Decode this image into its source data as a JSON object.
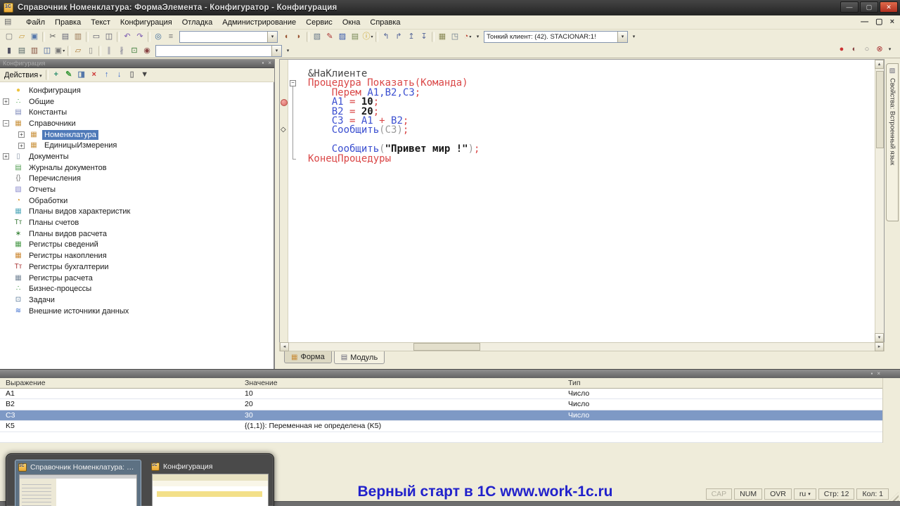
{
  "window": {
    "title": "Справочник Номенклатура: ФормаЭлемента - Конфигуратор - Конфигурация"
  },
  "menu": {
    "items": [
      {
        "n": "file",
        "label": "Файл"
      },
      {
        "n": "edit",
        "label": "Правка"
      },
      {
        "n": "text",
        "label": "Текст"
      },
      {
        "n": "configuration",
        "label": "Конфигурация"
      },
      {
        "n": "debug",
        "label": "Отладка"
      },
      {
        "n": "administration",
        "label": "Администрирование"
      },
      {
        "n": "service",
        "label": "Сервис"
      },
      {
        "n": "windows",
        "label": "Окна"
      },
      {
        "n": "help",
        "label": "Справка"
      }
    ]
  },
  "toolbar1": {
    "search_value": "",
    "client_combo": "Тонкий клиент: (42). STACIONAR:1!",
    "icons_a": [
      {
        "n": "new",
        "g": "▢",
        "c": "#777777"
      },
      {
        "n": "open",
        "g": "▱",
        "c": "#c89b3c"
      },
      {
        "n": "save",
        "g": "▣",
        "c": "#5577aa"
      },
      {
        "sep": true
      },
      {
        "n": "cut",
        "g": "✂",
        "c": "#555555"
      },
      {
        "n": "copy",
        "g": "▤",
        "c": "#666677"
      },
      {
        "n": "paste",
        "g": "▥",
        "c": "#997755"
      },
      {
        "sep": true
      },
      {
        "n": "print",
        "g": "▭",
        "c": "#555566"
      },
      {
        "n": "print-preview",
        "g": "◫",
        "c": "#555566"
      },
      {
        "sep": true
      },
      {
        "n": "back",
        "g": "↶",
        "c": "#7a5ab0"
      },
      {
        "n": "forward",
        "g": "↷",
        "c": "#7a5ab0"
      },
      {
        "sep": true
      },
      {
        "n": "find",
        "g": "◎",
        "c": "#3a6a9a"
      },
      {
        "n": "find-list",
        "g": "≡",
        "c": "#777777"
      }
    ],
    "icons_b": [
      {
        "n": "find-next",
        "g": "◖",
        "c": "#995533"
      },
      {
        "n": "find-prev",
        "g": "◗",
        "c": "#995533"
      },
      {
        "sep": true
      },
      {
        "n": "open-module",
        "g": "▧",
        "c": "#667788"
      },
      {
        "n": "syntax-check",
        "g": "✎",
        "c": "#aa3333"
      },
      {
        "n": "edit-object",
        "g": "▨",
        "c": "#3355aa"
      },
      {
        "n": "help-contents",
        "g": "▤",
        "c": "#778855"
      },
      {
        "n": "info",
        "g": "ⓘ",
        "c": "#c8a020",
        "arrow": true
      },
      {
        "sep": true
      },
      {
        "n": "proc-prev",
        "g": "↰",
        "c": "#556699"
      },
      {
        "n": "proc-next",
        "g": "↱",
        "c": "#556699"
      },
      {
        "n": "proc-list",
        "g": "↥",
        "c": "#556699"
      },
      {
        "n": "goto-definition",
        "g": "↧",
        "c": "#556699"
      },
      {
        "sep": true
      },
      {
        "n": "template",
        "g": "▦",
        "c": "#888855"
      },
      {
        "n": "show-calls",
        "g": "◳",
        "c": "#667788"
      },
      {
        "n": "performance-measure",
        "g": "◔",
        "c": "#bb4433",
        "arrow": true
      }
    ]
  },
  "toolbar2": {
    "proc_combo": "",
    "icons": [
      {
        "n": "lock",
        "g": "▮",
        "c": "#555566"
      },
      {
        "n": "properties",
        "g": "▤",
        "c": "#556666"
      },
      {
        "n": "output-table",
        "g": "▥",
        "c": "#885544"
      },
      {
        "n": "form-editor",
        "g": "◫",
        "c": "#3a5a9a"
      },
      {
        "n": "add-wizard",
        "g": "▣",
        "c": "#777777",
        "arrow": true
      },
      {
        "sep": true
      },
      {
        "n": "copy-fragment",
        "g": "▱",
        "c": "#aa7733"
      },
      {
        "n": "delete-fragment",
        "g": "▯",
        "c": "#888888"
      },
      {
        "sep": true
      },
      {
        "n": "comment",
        "g": "∥",
        "c": "#888899"
      },
      {
        "n": "uncomment",
        "g": "∦",
        "c": "#888899"
      },
      {
        "n": "syntax-check-module",
        "g": "⊡",
        "c": "#3a7a3a"
      },
      {
        "n": "find-procedure",
        "g": "◉",
        "c": "#884444"
      }
    ],
    "right_icons": [
      {
        "n": "breakpoint",
        "g": "●",
        "c": "#cc3333"
      },
      {
        "n": "breakpoint-temp",
        "g": "◐",
        "c": "#884444"
      },
      {
        "n": "breakpoint-disable",
        "g": "○",
        "c": "#888888"
      },
      {
        "n": "breakpoints-clear",
        "g": "⊗",
        "c": "#aa3333"
      }
    ]
  },
  "left_panel": {
    "caption": "Конфигурация",
    "actions_label": "Действия",
    "action_icons": [
      {
        "n": "add",
        "g": "+",
        "c": "#2f8f6f"
      },
      {
        "n": "edit",
        "g": "✎",
        "c": "#3f9a3f"
      },
      {
        "n": "copy",
        "g": "◨",
        "c": "#5577aa"
      },
      {
        "n": "delete",
        "g": "×",
        "c": "#cc3333"
      },
      {
        "n": "move-up",
        "g": "↑",
        "c": "#3366cc"
      },
      {
        "n": "move-down",
        "g": "↓",
        "c": "#3366cc"
      },
      {
        "n": "properties",
        "g": "▯",
        "c": "#777777"
      },
      {
        "n": "filter",
        "g": "▼",
        "c": "#444444"
      }
    ],
    "tree": [
      {
        "n": "config",
        "label": "Конфигурация",
        "level": 0,
        "exp": "",
        "icon": {
          "g": "●",
          "c": "#eec23c"
        }
      },
      {
        "n": "common",
        "label": "Общие",
        "level": 0,
        "exp": "+",
        "icon": {
          "g": "∴",
          "c": "#3a9a3a"
        }
      },
      {
        "n": "constants",
        "label": "Константы",
        "level": 0,
        "exp": "",
        "icon": {
          "g": "▤",
          "c": "#7a86b8"
        }
      },
      {
        "n": "catalogs",
        "label": "Справочники",
        "level": 0,
        "exp": "−",
        "icon": {
          "g": "▦",
          "c": "#c9923d"
        }
      },
      {
        "n": "nomenclature",
        "label": "Номенклатура",
        "level": 1,
        "exp": "+",
        "icon": {
          "g": "▦",
          "c": "#c9923d"
        },
        "sel": true
      },
      {
        "n": "units",
        "label": "ЕдиницыИзмерения",
        "level": 1,
        "exp": "+",
        "icon": {
          "g": "▦",
          "c": "#c9923d"
        }
      },
      {
        "n": "documents",
        "label": "Документы",
        "level": 0,
        "exp": "+",
        "icon": {
          "g": "▯",
          "c": "#8a97a8"
        }
      },
      {
        "n": "journals",
        "label": "Журналы документов",
        "level": 0,
        "exp": "",
        "icon": {
          "g": "▤",
          "c": "#55a055"
        }
      },
      {
        "n": "enums",
        "label": "Перечисления",
        "level": 0,
        "exp": "",
        "icon": {
          "g": "{}",
          "c": "#777777"
        }
      },
      {
        "n": "reports",
        "label": "Отчеты",
        "level": 0,
        "exp": "",
        "icon": {
          "g": "▧",
          "c": "#8a8acc"
        }
      },
      {
        "n": "processors",
        "label": "Обработки",
        "level": 0,
        "exp": "",
        "icon": {
          "g": "◔",
          "c": "#d89a30"
        }
      },
      {
        "n": "char-types",
        "label": "Планы видов характеристик",
        "level": 0,
        "exp": "",
        "icon": {
          "g": "▦",
          "c": "#55aabb"
        }
      },
      {
        "n": "accounts",
        "label": "Планы счетов",
        "level": 0,
        "exp": "",
        "icon": {
          "g": "Тт",
          "c": "#3a7a3a"
        }
      },
      {
        "n": "calc-types",
        "label": "Планы видов расчета",
        "level": 0,
        "exp": "",
        "icon": {
          "g": "∗",
          "c": "#2a7a2a"
        }
      },
      {
        "n": "info-registers",
        "label": "Регистры сведений",
        "level": 0,
        "exp": "",
        "icon": {
          "g": "▦",
          "c": "#4a9a4a"
        }
      },
      {
        "n": "accum-registers",
        "label": "Регистры накопления",
        "level": 0,
        "exp": "",
        "icon": {
          "g": "▦",
          "c": "#cc8833"
        }
      },
      {
        "n": "acc-registers",
        "label": "Регистры бухгалтерии",
        "level": 0,
        "exp": "",
        "icon": {
          "g": "Тт",
          "c": "#aa3333"
        }
      },
      {
        "n": "calc-registers",
        "label": "Регистры расчета",
        "level": 0,
        "exp": "",
        "icon": {
          "g": "▦",
          "c": "#778899"
        }
      },
      {
        "n": "business-processes",
        "label": "Бизнес-процессы",
        "level": 0,
        "exp": "",
        "icon": {
          "g": "∴",
          "c": "#2a8a2a"
        }
      },
      {
        "n": "tasks",
        "label": "Задачи",
        "level": 0,
        "exp": "",
        "icon": {
          "g": "⊡",
          "c": "#5a7a9a"
        }
      },
      {
        "n": "ext-sources",
        "label": "Внешние источники данных",
        "level": 0,
        "exp": "",
        "icon": {
          "g": "≋",
          "c": "#3366cc"
        }
      }
    ]
  },
  "editor": {
    "lines": [
      [
        {
          "t": "&НаКлиенте",
          "c": "dir"
        }
      ],
      [
        {
          "t": "Процедура",
          "c": "kw"
        },
        {
          "t": " ",
          "c": "pl"
        },
        {
          "t": "Показать(Команда)",
          "c": "kw"
        }
      ],
      [
        {
          "t": "    ",
          "c": "pl"
        },
        {
          "t": "Перем",
          "c": "kw"
        },
        {
          "t": " ",
          "c": "pl"
        },
        {
          "t": "А1,В2,С3",
          "c": "id"
        },
        {
          "t": ";",
          "c": "op"
        }
      ],
      [
        {
          "t": "    ",
          "c": "pl"
        },
        {
          "t": "А1 ",
          "c": "id"
        },
        {
          "t": "= ",
          "c": "op"
        },
        {
          "t": "10",
          "c": "num"
        },
        {
          "t": ";",
          "c": "op"
        }
      ],
      [
        {
          "t": "    ",
          "c": "pl"
        },
        {
          "t": "В2 ",
          "c": "id"
        },
        {
          "t": "= ",
          "c": "op"
        },
        {
          "t": "20",
          "c": "num"
        },
        {
          "t": ";",
          "c": "op"
        }
      ],
      [
        {
          "t": "    ",
          "c": "pl"
        },
        {
          "t": "С3 ",
          "c": "id"
        },
        {
          "t": "= ",
          "c": "op"
        },
        {
          "t": "А1 ",
          "c": "id"
        },
        {
          "t": "+ ",
          "c": "op"
        },
        {
          "t": "В2",
          "c": "id"
        },
        {
          "t": ";",
          "c": "op"
        }
      ],
      [
        {
          "t": "    ",
          "c": "pl"
        },
        {
          "t": "Сообщить",
          "c": "id"
        },
        {
          "t": "(",
          "c": "par"
        },
        {
          "t": "С3",
          "c": "par"
        },
        {
          "t": ")",
          "c": "par"
        },
        {
          "t": ";",
          "c": "op"
        }
      ],
      [
        {
          "t": "",
          "c": "pl"
        }
      ],
      [
        {
          "t": "    ",
          "c": "pl"
        },
        {
          "t": "Сообщить",
          "c": "id"
        },
        {
          "t": "(",
          "c": "par"
        },
        {
          "t": "\"Привет мир !\"",
          "c": "str"
        },
        {
          "t": ")",
          "c": "par"
        },
        {
          "t": ";",
          "c": "op"
        }
      ],
      [
        {
          "t": "КонецПроцедуры",
          "c": "kw"
        }
      ]
    ],
    "tabs": [
      {
        "n": "form",
        "label": "Форма",
        "icon_glyph": "▦",
        "icon_color": "#c98f3d"
      },
      {
        "n": "module",
        "label": "Модуль",
        "icon_glyph": "▤",
        "icon_color": "#666677",
        "active": true
      }
    ]
  },
  "right_tab": {
    "label": "Свойства: Встроенный язык"
  },
  "watch": {
    "headers": [
      "Выражение",
      "Значение",
      "Тип"
    ],
    "rows": [
      {
        "n": "a1",
        "e": "A1",
        "v": "10",
        "t": "Число"
      },
      {
        "n": "b2",
        "e": "B2",
        "v": "20",
        "t": "Число"
      },
      {
        "n": "c3",
        "e": "C3",
        "v": "30",
        "t": "Число",
        "sel": true
      },
      {
        "n": "k5",
        "e": "K5",
        "v": "{(1,1)}: Переменная не определена (K5)",
        "t": ""
      },
      {
        "n": "empty",
        "e": "",
        "v": "",
        "t": ""
      }
    ]
  },
  "switcher": {
    "items": [
      {
        "label": "Справочник Номенклатура: Ф...",
        "selected": true
      },
      {
        "label": "Конфигурация",
        "selected": false
      }
    ]
  },
  "footer": {
    "promo": "Верный старт в 1С www.work-1c.ru"
  },
  "status": {
    "cells": [
      {
        "n": "caps",
        "label": "CAP",
        "dim": true
      },
      {
        "n": "num",
        "label": "NUM"
      },
      {
        "n": "ovr",
        "label": "OVR"
      },
      {
        "n": "lang",
        "label": "ru",
        "arrow": true
      },
      {
        "n": "line",
        "label": "Стр: 12"
      },
      {
        "n": "col",
        "label": "Кол: 1"
      }
    ]
  }
}
